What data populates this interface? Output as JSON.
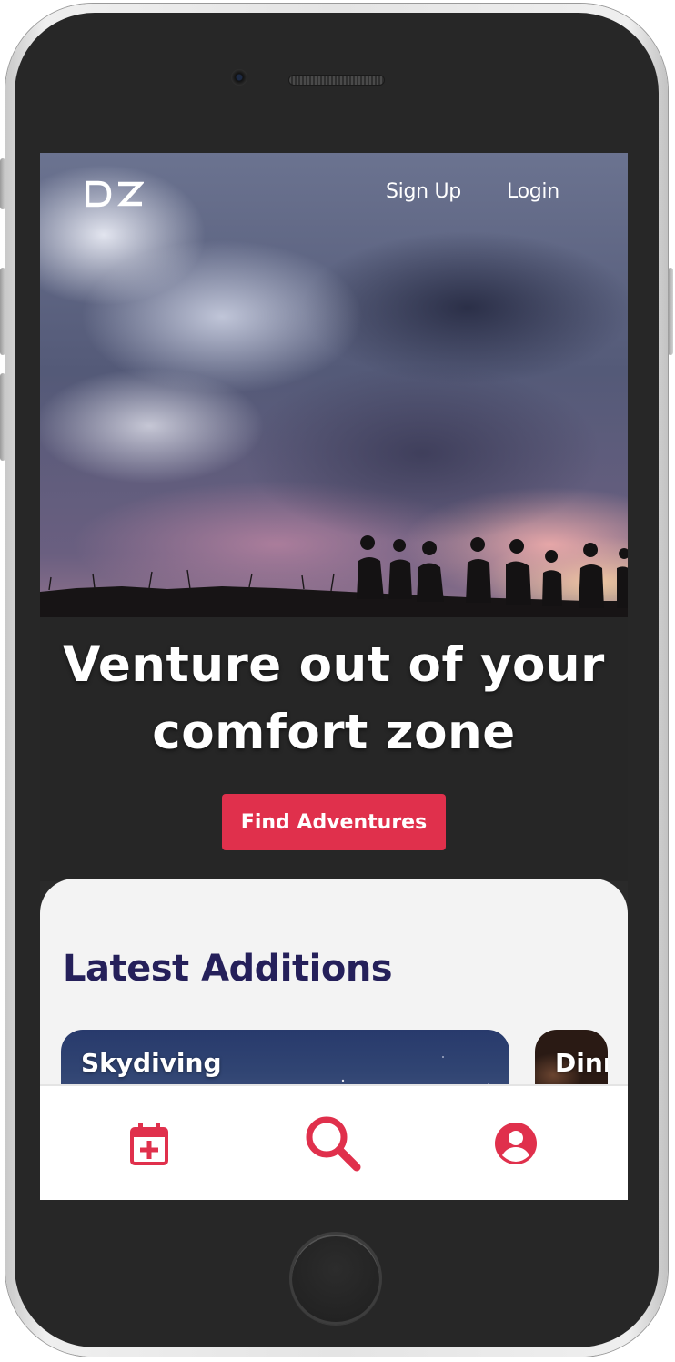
{
  "header": {
    "logo_text": "DZ",
    "nav": {
      "signup_label": "Sign Up",
      "login_label": "Login"
    }
  },
  "hero": {
    "headline_line1": "Venture out of your",
    "headline_line2": "comfort zone",
    "cta_label": "Find Adventures"
  },
  "latest": {
    "title": "Latest Additions",
    "cards": [
      {
        "title": "Skydiving"
      },
      {
        "title": "Dinn"
      }
    ]
  },
  "tabbar": {
    "items": [
      {
        "icon": "calendar-add-icon"
      },
      {
        "icon": "search-icon"
      },
      {
        "icon": "profile-icon"
      }
    ]
  },
  "colors": {
    "accent": "#e0304c",
    "title": "#25205a",
    "sheet_bg": "#f3f3f3"
  }
}
